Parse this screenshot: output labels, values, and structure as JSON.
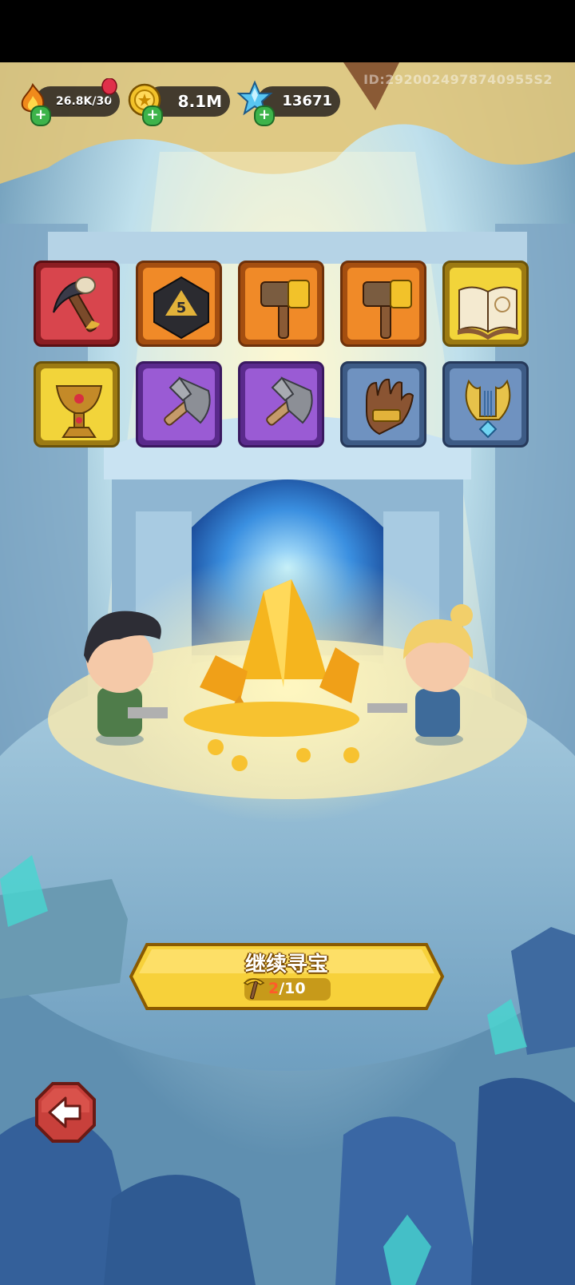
{
  "resources": {
    "energy": {
      "icon": "flame-icon",
      "value": "26.8K/30"
    },
    "gold": {
      "icon": "gold-coin-icon",
      "value": "8.1M"
    },
    "gems": {
      "icon": "blue-crystal-icon",
      "value": "13671"
    }
  },
  "user_id": "ID:2920024978740955S2",
  "items": [
    {
      "name": "bone-scythe-icon",
      "rarity": "red"
    },
    {
      "name": "d20-dice-icon",
      "rarity": "orange"
    },
    {
      "name": "war-hammer-icon",
      "rarity": "orange"
    },
    {
      "name": "war-hammer-icon",
      "rarity": "orange"
    },
    {
      "name": "spellbook-icon",
      "rarity": "gold"
    },
    {
      "name": "jeweled-chalice-icon",
      "rarity": "gold"
    },
    {
      "name": "battle-axe-icon",
      "rarity": "purple"
    },
    {
      "name": "battle-axe-icon",
      "rarity": "purple"
    },
    {
      "name": "leather-glove-icon",
      "rarity": "blue"
    },
    {
      "name": "golden-lyre-icon",
      "rarity": "blue"
    }
  ],
  "action": {
    "label": "继续寻宝",
    "icon": "golden-pickaxe-icon",
    "count_current": "2",
    "count_total": "/10"
  },
  "back_button": {
    "icon": "back-arrow-icon"
  },
  "colors": {
    "button_yellow": "#f7d13a",
    "button_border": "#8a5a00",
    "back_red": "#c8403b"
  }
}
